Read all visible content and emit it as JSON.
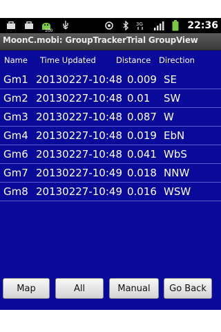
{
  "status_bar": {
    "time": "22:36",
    "icons": [
      "briefcase-icon",
      "briefcase-icon",
      "android-download-icon",
      "usb-icon",
      "gps-icon",
      "bluetooth-icon",
      "network-3g-icon",
      "signal-icon",
      "battery-icon"
    ],
    "download_badge": "100"
  },
  "app": {
    "title": "MoonC.mobi: GroupTrackerTrial GroupView"
  },
  "table": {
    "headers": {
      "name": "Name",
      "time": "Time Updated",
      "distance": "Distance",
      "direction": "Direction"
    },
    "rows": [
      {
        "name": "Gm1",
        "time": "20130227-10:48",
        "distance": "0.009",
        "direction": "SE"
      },
      {
        "name": "Gm2",
        "time": "20130227-10:48",
        "distance": "0.01",
        "direction": "SW"
      },
      {
        "name": "Gm3",
        "time": "20130227-10:48",
        "distance": "0.087",
        "direction": "W"
      },
      {
        "name": "Gm4",
        "time": "20130227-10:48",
        "distance": "0.019",
        "direction": "EbN"
      },
      {
        "name": "Gm6",
        "time": "20130227-10:48",
        "distance": "0.041",
        "direction": "WbS"
      },
      {
        "name": "Gm7",
        "time": "20130227-10:49",
        "distance": "0.018",
        "direction": "NNW"
      },
      {
        "name": "Gm8",
        "time": "20130227-10:49",
        "distance": "0.016",
        "direction": "WSW"
      }
    ]
  },
  "buttons": {
    "map": "Map",
    "all": "All",
    "manual": "Manual",
    "go_back": "Go Back"
  },
  "colors": {
    "background": "#0a0a9a",
    "row_divider": "#5b5bd0",
    "titlebar": "#4a4a4a",
    "statusbar": "#000000"
  }
}
